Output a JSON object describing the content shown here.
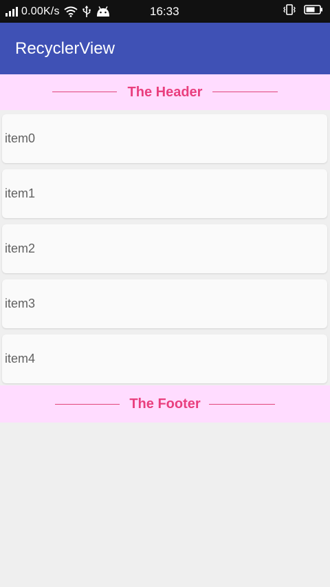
{
  "status_bar": {
    "speed": "0.00K/s",
    "time": "16:33",
    "icons": [
      "signal-icon",
      "wifi-icon",
      "usb-icon",
      "android-icon",
      "vibrate-icon",
      "battery-icon"
    ]
  },
  "app_bar": {
    "title": "RecyclerView",
    "color": "#3f51b5"
  },
  "header": {
    "text": "The Header",
    "background": "#ffdcff",
    "accent": "#e93f7e"
  },
  "items": [
    {
      "label": "item0"
    },
    {
      "label": "item1"
    },
    {
      "label": "item2"
    },
    {
      "label": "item3"
    },
    {
      "label": "item4"
    }
  ],
  "footer": {
    "text": "The Footer",
    "background": "#ffdcff",
    "accent": "#e93f7e"
  }
}
